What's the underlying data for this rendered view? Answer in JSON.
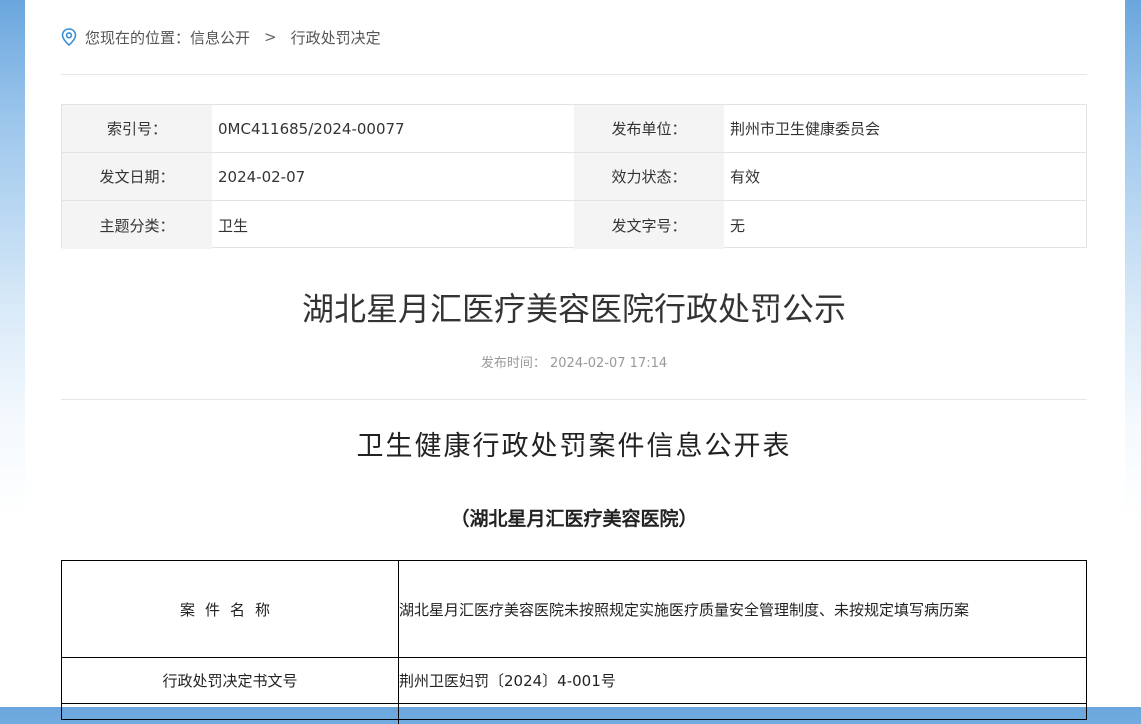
{
  "breadcrumb": {
    "prefix": "您现在的位置：",
    "level1": "信息公开",
    "separator": ">",
    "level2": "行政处罚决定"
  },
  "meta": {
    "index_label": "索引号：",
    "index_value": "0MC411685/2024-00077",
    "publisher_label": "发布单位：",
    "publisher_value": "荆州市卫生健康委员会",
    "date_label": "发文日期：",
    "date_value": "2024-02-07",
    "status_label": "效力状态：",
    "status_value": "有效",
    "topic_label": "主题分类：",
    "topic_value": "卫生",
    "docno_label": "发文字号：",
    "docno_value": "无"
  },
  "article": {
    "title": "湖北星月汇医疗美容医院行政处罚公示",
    "pubtime_label": "发布时间：",
    "pubtime_value": "2024-02-07 17:14"
  },
  "document": {
    "title": "卫生健康行政处罚案件信息公开表",
    "subtitle": "（湖北星月汇医疗美容医院）",
    "rows": [
      {
        "label": "案件名称",
        "value": "湖北星月汇医疗美容医院未按照规定实施医疗质量安全管理制度、未按规定填写病历案"
      },
      {
        "label": "行政处罚决定书文号",
        "value": "荆州卫医妇罚〔2024〕4-001号"
      }
    ]
  },
  "colors": {
    "background_top": "#6aa6dd",
    "icon": "#3a8fd6"
  }
}
